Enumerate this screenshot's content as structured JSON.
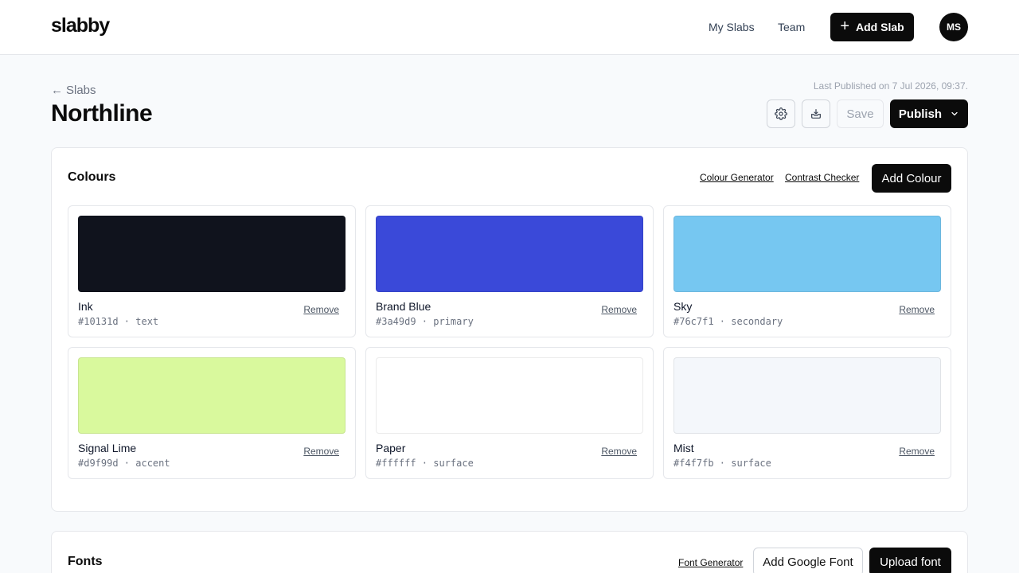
{
  "app": {
    "logo": "slabby"
  },
  "nav": {
    "my_slabs": "My Slabs",
    "team": "Team",
    "add_slab": "Add Slab",
    "add_icon": "+",
    "avatar": "MS"
  },
  "page": {
    "breadcrumb_arrow": "←",
    "breadcrumb": "Slabs",
    "title": "Northline",
    "last_published": "Last Published on 7 Jul 2026, 09:37.",
    "save": "Save",
    "publish": "Publish"
  },
  "colours": {
    "title": "Colours",
    "generator_link": "Colour Generator",
    "contrast_link": "Contrast Checker",
    "add_button": "Add Colour",
    "remove_label": "Remove",
    "items": [
      {
        "name": "Ink",
        "meta": "#10131d · text",
        "color": "#10131d"
      },
      {
        "name": "Brand Blue",
        "meta": "#3a49d9 · primary",
        "color": "#3a49d9"
      },
      {
        "name": "Sky",
        "meta": "#76c7f1 · secondary",
        "color": "#76c7f1"
      },
      {
        "name": "Signal Lime",
        "meta": "#d9f99d · accent",
        "color": "#d9f99d"
      },
      {
        "name": "Paper",
        "meta": "#ffffff · surface",
        "color": "#ffffff"
      },
      {
        "name": "Mist",
        "meta": "#f4f7fb · surface",
        "color": "#f4f7fb"
      }
    ]
  },
  "fonts": {
    "title": "Fonts",
    "generator_link": "Font Generator",
    "add_google": "Add Google Font",
    "upload": "Upload font"
  }
}
